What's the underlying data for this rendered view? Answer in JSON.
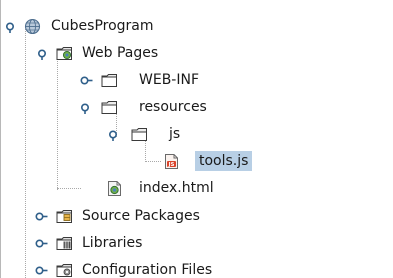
{
  "tree": {
    "root": {
      "label": "CubesProgram",
      "icon": "globe-project-icon",
      "expanded": true
    },
    "web_pages": {
      "label": "Web Pages",
      "icon": "web-pages-folder-icon",
      "expanded": true
    },
    "web_inf": {
      "label": "WEB-INF",
      "icon": "folder-icon",
      "expanded": false
    },
    "resources": {
      "label": "resources",
      "icon": "folder-open-icon",
      "expanded": true
    },
    "js": {
      "label": "js",
      "icon": "folder-open-icon",
      "expanded": true
    },
    "tools_js": {
      "label": "tools.js",
      "icon": "javascript-file-icon",
      "selected": true
    },
    "index_html": {
      "label": "index.html",
      "icon": "html-file-icon"
    },
    "source_packages": {
      "label": "Source Packages",
      "icon": "source-packages-icon",
      "expanded": false
    },
    "libraries": {
      "label": "Libraries",
      "icon": "libraries-icon",
      "expanded": false
    },
    "configuration_files": {
      "label": "Configuration Files",
      "icon": "configuration-files-icon",
      "expanded": false
    }
  },
  "colors": {
    "selection": "#b8cfe5",
    "toggle": "#2f5f8a",
    "folder": "#ffffff",
    "folder_border": "#3a3a3a"
  }
}
